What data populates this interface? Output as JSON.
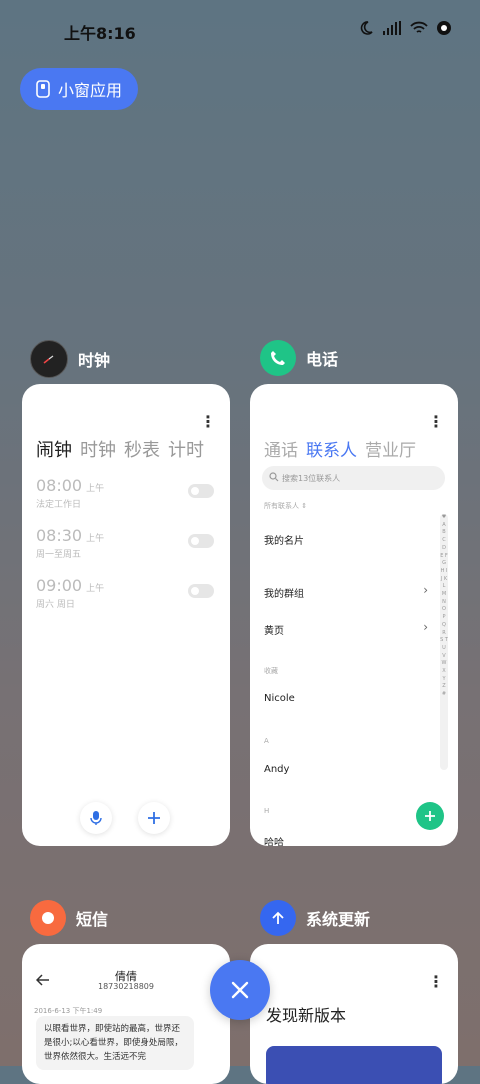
{
  "status_bar": {
    "time": "上午8:16",
    "icons": [
      "moon-icon",
      "signal-icon",
      "wifi-icon",
      "battery-icon"
    ]
  },
  "small_window": {
    "label": "小窗应用",
    "icon": "small-window-icon",
    "color": "#4a78f2"
  },
  "apps": {
    "clock": {
      "name": "时钟",
      "tabs": [
        "闹钟",
        "时钟",
        "秒表",
        "计时"
      ],
      "alarms": [
        {
          "time": "08:00",
          "ampm": "上午",
          "desc": "法定工作日"
        },
        {
          "time": "08:30",
          "ampm": "上午",
          "desc": "周一至周五"
        },
        {
          "time": "09:00",
          "ampm": "上午",
          "desc": "周六 周日"
        }
      ]
    },
    "phone": {
      "name": "电话",
      "tabs": [
        "通话",
        "联系人",
        "营业厅"
      ],
      "search_placeholder": "搜索13位联系人",
      "filter_label": "所有联系人",
      "my_card": "我的名片",
      "my_groups": "我的群组",
      "yellow_pages": "黄页",
      "section_favorites": "收藏",
      "contact_nicole": "Nicole",
      "section_a": "A",
      "contact_andy": "Andy",
      "section_h": "H",
      "contact_haha": "哈哈",
      "alpha_index": "♥ A B C D E F G H I J K L M N O P Q R S T U V W X Y Z #",
      "accent_color": "#1fc487"
    },
    "sms": {
      "name": "短信",
      "contact_name": "倩倩",
      "contact_number": "18730218809",
      "timestamp": "2016-6-13 下午1:49",
      "message": "以眼看世界，即使站的最高，世界还是很小;以心看世界，即使身处局限，世界依然很大。生活远不完"
    },
    "update": {
      "name": "系统更新",
      "title": "发现新版本"
    }
  }
}
